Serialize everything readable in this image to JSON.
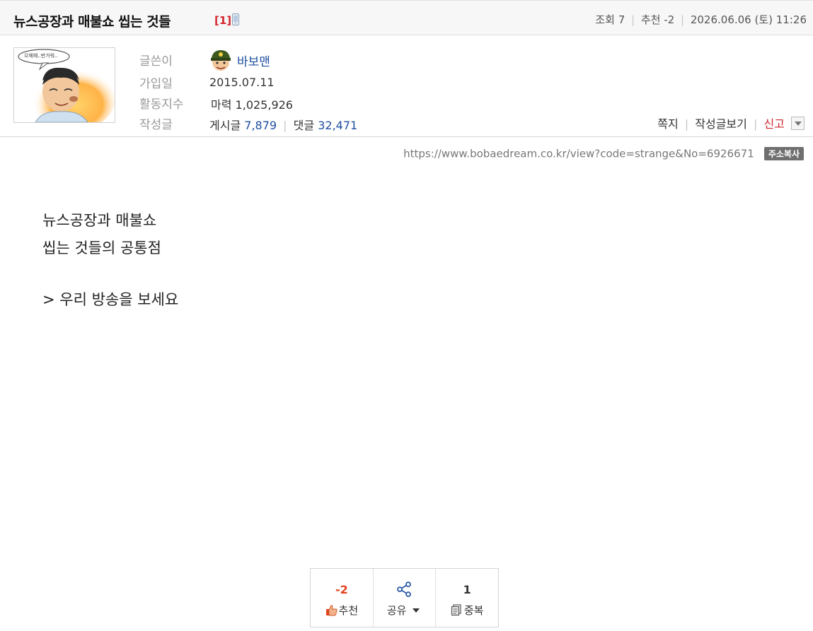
{
  "post": {
    "title": "뉴스공장과 매불쇼 씹는 것들",
    "comment_count": "[1]",
    "views_label": "조회",
    "views": "7",
    "recommend_label": "추천",
    "recommend": "-2",
    "date": "2026.06.06 (토) 11:26"
  },
  "author": {
    "avatar_caption": "으헤헤..반가워..",
    "writer_label": "글쓴이",
    "nickname": "바보맨",
    "join_label": "가입일",
    "join_date": "2015.07.11",
    "activity_label": "활동지수",
    "power_label": "마력",
    "power_value": "1,025,926",
    "written_label": "작성글",
    "posts_label": "게시글",
    "posts_count": "7,879",
    "comments_label": "댓글",
    "comments_count": "32,471"
  },
  "actions": {
    "message": "쪽지",
    "view_posts": "작성글보기",
    "report": "신고"
  },
  "url": {
    "address": "https://www.bobaedream.co.kr/view?code=strange&No=6926671",
    "copy_label": "주소복사"
  },
  "content": {
    "line1": "뉴스공장과 매불쇼",
    "line2": "씹는 것들의 공통점",
    "line3": "> 우리 방송을 보세요"
  },
  "votes": {
    "recommend_count": "-2",
    "recommend_label": "추천",
    "share_label": "공유",
    "duplicate_count": "1",
    "duplicate_label": "중복"
  },
  "colors": {
    "accent_red": "#d4262c",
    "link_blue": "#1f4fa0",
    "vote_red": "#e2431d"
  }
}
